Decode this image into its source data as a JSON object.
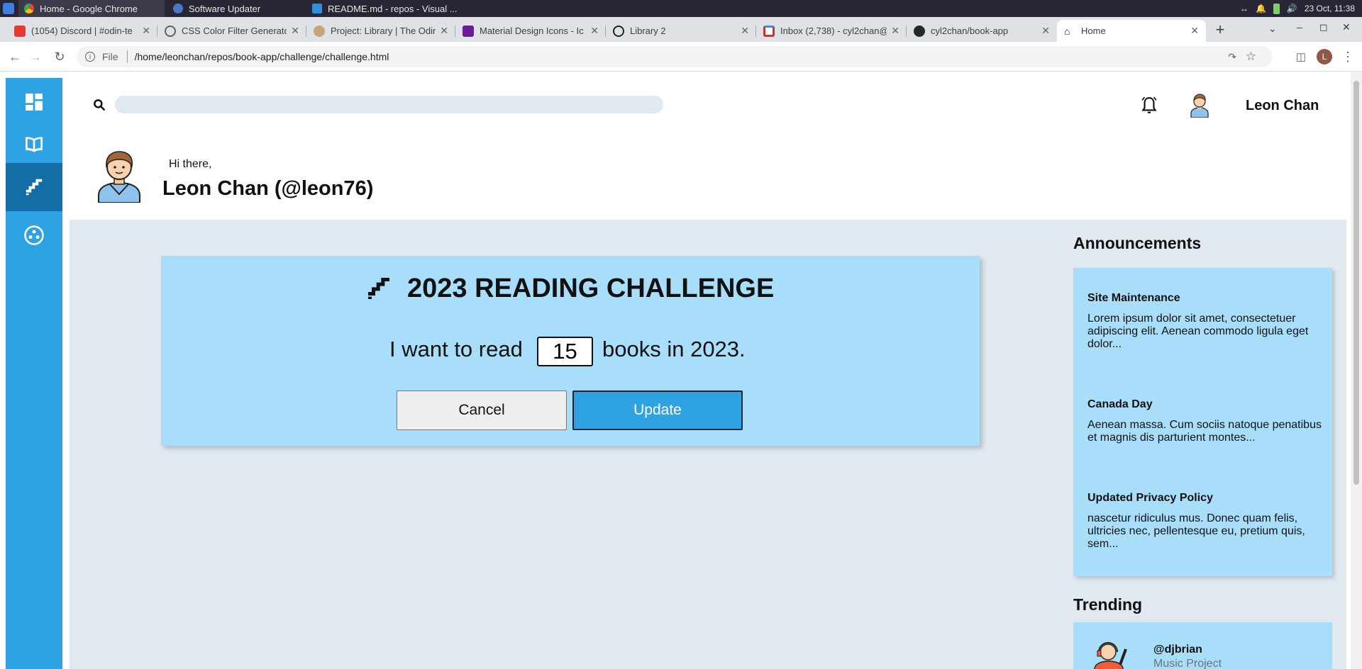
{
  "os": {
    "tasks": [
      {
        "label": "Home - Google Chrome",
        "active": true
      },
      {
        "label": "Software Updater",
        "active": false
      },
      {
        "label": "README.md - repos - Visual ...",
        "active": false
      }
    ],
    "datetime": "23 Oct, 11:38"
  },
  "browser": {
    "tabs": [
      {
        "title": "(1054) Discord | #odin-te",
        "icon": "discord-icon",
        "color": "#e53935"
      },
      {
        "title": "CSS Color Filter Generator",
        "icon": "globe-icon",
        "color": "#5f6368"
      },
      {
        "title": "Project: Library | The Odin",
        "icon": "odin-icon",
        "color": "#c8a27a"
      },
      {
        "title": "Material Design Icons - Ic",
        "icon": "mdi-icon",
        "color": "#6a1b9a"
      },
      {
        "title": "Library 2",
        "icon": "codepen-icon",
        "color": "#222222"
      },
      {
        "title": "Inbox (2,738) - cyl2chan@",
        "icon": "gmail-icon",
        "color": "#d93025"
      },
      {
        "title": "cyl2chan/book-app",
        "icon": "github-icon",
        "color": "#24292f"
      },
      {
        "title": "Home",
        "icon": "home-icon",
        "color": "#202124",
        "active": true
      }
    ],
    "new_tab": "+",
    "address_scheme": "File",
    "address": "/home/leonchan/repos/book-app/challenge/challenge.html",
    "profile_initial": "L"
  },
  "header": {
    "search_placeholder": "",
    "username": "Leon Chan"
  },
  "profile": {
    "greeting": "Hi there,",
    "name": "Leon Chan (@leon76)"
  },
  "challenge": {
    "title": "2023 READING CHALLENGE",
    "sentence_before": "I want to read",
    "goal": "15",
    "sentence_after": "books in 2023.",
    "cancel_label": "Cancel",
    "update_label": "Update"
  },
  "announcements": {
    "heading": "Announcements",
    "items": [
      {
        "title": "Site Maintenance",
        "body": "Lorem ipsum dolor sit amet, consectetuer adipiscing elit. Aenean commodo ligula eget dolor..."
      },
      {
        "title": "Canada Day",
        "body": "Aenean massa. Cum sociis natoque penatibus et magnis dis parturient montes..."
      },
      {
        "title": "Updated Privacy Policy",
        "body": "nascetur ridiculus mus. Donec quam felis, ultricies nec, pellentesque eu, pretium quis, sem..."
      }
    ]
  },
  "trending": {
    "heading": "Trending",
    "items": [
      {
        "handle": "@djbrian",
        "subtitle": "Music Project"
      }
    ]
  },
  "colors": {
    "sidebar": "#2ea3e3",
    "sidebar_active": "#136ea6",
    "card": "#a8def9",
    "page_bg": "#e2e8f0",
    "update_button": "#2ea3e3"
  }
}
